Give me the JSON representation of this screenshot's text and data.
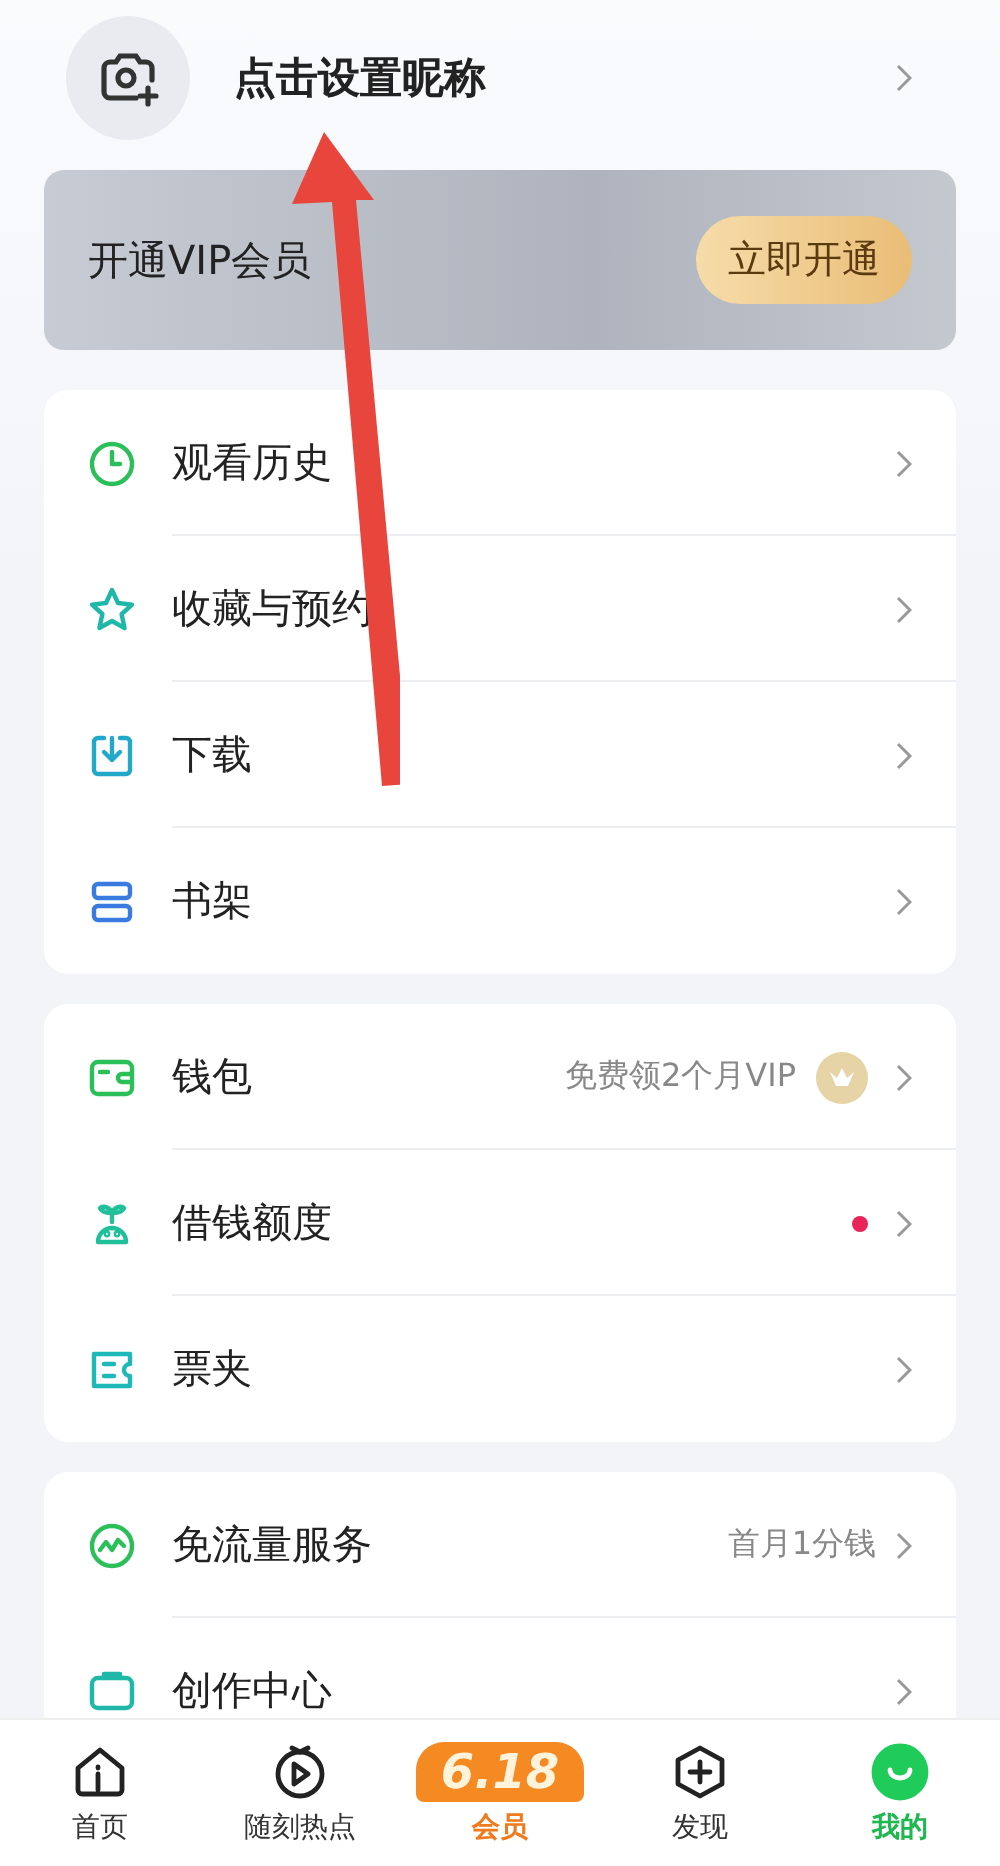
{
  "profile": {
    "nickname": "点击设置昵称"
  },
  "vip_banner": {
    "title": "开通VIP会员",
    "button": "立即开通"
  },
  "sections": [
    {
      "items": [
        {
          "kind": "history",
          "label": "观看历史"
        },
        {
          "kind": "star",
          "label": "收藏与预约"
        },
        {
          "kind": "download",
          "label": "下载"
        },
        {
          "kind": "shelf",
          "label": "书架"
        }
      ]
    },
    {
      "items": [
        {
          "kind": "wallet",
          "label": "钱包",
          "note": "免费领2个月VIP",
          "vip_badge": true
        },
        {
          "kind": "loan",
          "label": "借钱额度",
          "unread": true
        },
        {
          "kind": "ticket",
          "label": "票夹"
        }
      ]
    },
    {
      "items": [
        {
          "kind": "traffic",
          "label": "免流量服务",
          "note": "首月1分钱"
        },
        {
          "kind": "create",
          "label": "创作中心"
        }
      ]
    }
  ],
  "tab_bar": [
    {
      "kind": "home",
      "label": "首页",
      "selected": false
    },
    {
      "kind": "hot",
      "label": "随刻热点",
      "selected": false
    },
    {
      "kind": "vip",
      "label": "会员",
      "badge": "6.18",
      "selected": false
    },
    {
      "kind": "discover",
      "label": "发现",
      "selected": false
    },
    {
      "kind": "me",
      "label": "我的",
      "selected": true
    }
  ],
  "annotation": {
    "kind": "arrow"
  }
}
